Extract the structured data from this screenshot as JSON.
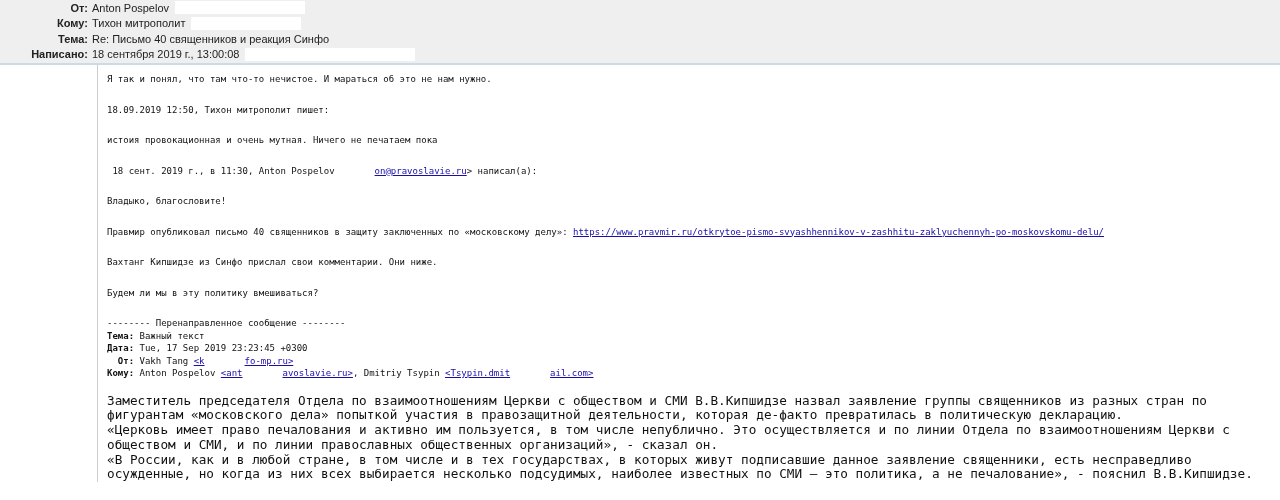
{
  "header": {
    "fields": [
      {
        "label": "От:",
        "value": "Anton Pospelov",
        "redacted": true
      },
      {
        "label": "Кому:",
        "value": "Тихон митрополит",
        "redacted": true
      },
      {
        "label": "Тема:",
        "value": "Re: Письмо 40 священников и реакция Синфо",
        "redacted": false
      },
      {
        "label": "Написано:",
        "value": "18 сентября 2019 г., 13:00:08",
        "redacted": true
      }
    ]
  },
  "message": {
    "paragraphs": [
      {
        "lines": [
          {
            "segments": [
              {
                "kind": "text",
                "text": "Я так и понял, что там что-то нечистое. И мараться об это не нам нужно."
              }
            ]
          }
        ]
      },
      {
        "lines": [
          {
            "segments": [
              {
                "kind": "text",
                "text": "18.09.2019 12:50, Тихон митрополит пишет:"
              }
            ]
          }
        ]
      },
      {
        "lines": [
          {
            "segments": [
              {
                "kind": "text",
                "text": "истоия провокационная и очень мутная. Ничего не печатаем пока"
              }
            ]
          }
        ]
      },
      {
        "lines": [
          {
            "segments": [
              {
                "kind": "text",
                "text": " 18 сент. 2019 г., в 11:30, Anton Pospelov"
              },
              {
                "kind": "gap"
              },
              {
                "kind": "link",
                "text": "on@pravoslavie.ru"
              },
              {
                "kind": "text",
                "text": "> написал(а):"
              }
            ]
          }
        ]
      },
      {
        "lines": [
          {
            "segments": [
              {
                "kind": "text",
                "text": "Владыко, благословите!"
              }
            ]
          }
        ]
      },
      {
        "lines": [
          {
            "segments": [
              {
                "kind": "text",
                "text": "Правмир опубликовал письмо 40 священников в защиту заключенных по «московскому делу»: "
              },
              {
                "kind": "link",
                "text": "https://www.pravmir.ru/otkrytoe-pismo-svyashhennikov-v-zashhitu-zaklyuchennyh-po-moskovskomu-delu/"
              }
            ]
          }
        ]
      },
      {
        "lines": [
          {
            "segments": [
              {
                "kind": "text",
                "text": "Вахтанг Кипшидзе из Синфо прислал свои комментарии. Они ниже."
              }
            ]
          }
        ]
      },
      {
        "lines": [
          {
            "segments": [
              {
                "kind": "text",
                "text": "Будем ли мы в эту политику вмешиваться?"
              }
            ]
          }
        ]
      },
      {
        "lines": [
          {
            "segments": [
              {
                "kind": "text",
                "text": "-------- Перенаправленное сообщение --------"
              }
            ]
          },
          {
            "segments": [
              {
                "kind": "label",
                "text": "Тема:"
              },
              {
                "kind": "text",
                "text": " Важный текст"
              }
            ]
          },
          {
            "segments": [
              {
                "kind": "label",
                "text": "Дата:"
              },
              {
                "kind": "text",
                "text": " Tue, 17 Sep 2019 23:23:45 +0300"
              }
            ]
          },
          {
            "segments": [
              {
                "kind": "label",
                "text": "  От:"
              },
              {
                "kind": "text",
                "text": " Vakh Tang "
              },
              {
                "kind": "link",
                "text": "<k"
              },
              {
                "kind": "gap"
              },
              {
                "kind": "link",
                "text": "fo-mp.ru>"
              }
            ]
          },
          {
            "segments": [
              {
                "kind": "label",
                "text": "Кому:"
              },
              {
                "kind": "text",
                "text": " Anton Pospelov "
              },
              {
                "kind": "link",
                "text": "<ant"
              },
              {
                "kind": "gap"
              },
              {
                "kind": "link",
                "text": "avoslavie.ru>"
              },
              {
                "kind": "text",
                "text": ", Dmitriy Tsypin "
              },
              {
                "kind": "link",
                "text": "<Tsypin.dmit"
              },
              {
                "kind": "gap"
              },
              {
                "kind": "link",
                "text": "ail.com>"
              }
            ]
          }
        ]
      }
    ],
    "article": [
      "Заместитель председателя Отдела по взаимоотношениям Церкви с обществом и СМИ В.В.Кипшидзе назвал заявление группы священников из разных стран по фигурантам «московского дела» попыткой участия в правозащитной деятельности, которая де-факто превратилась в политическую декларацию.",
      "«Церковь имеет право печалования и активно им пользуется, в том числе непублично. Это осуществляется и по линии Отдела по взаимоотношениям Церкви с обществом и СМИ, и по линии православных общественных организаций», - сказал он.",
      "«В России, как и в любой стране, в том числе и в тех государствах, в которых живут подписавшие данное заявление священники, есть несправедливо осужденные, но когда из них всех выбирается несколько подсудимых, наиболее известных по СМИ – это политика, а не печалование», - пояснил В.В.Кипшидзе."
    ]
  }
}
